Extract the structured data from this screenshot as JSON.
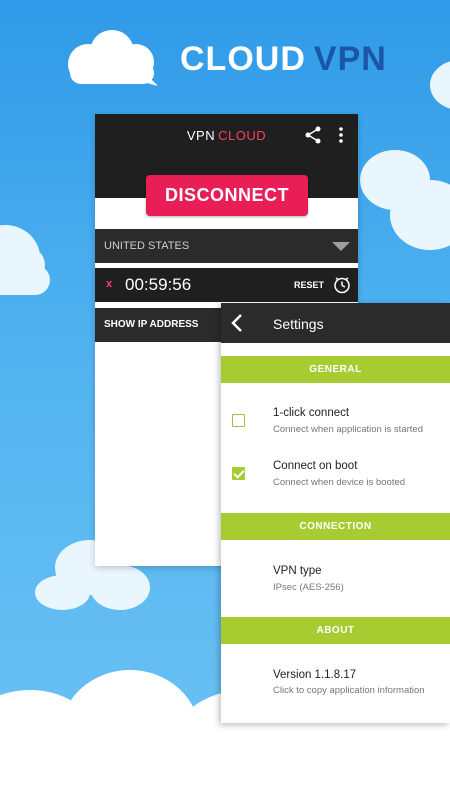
{
  "header": {
    "brand_word": "CLOUD",
    "accent_word": "VPN",
    "brand_icon": "cloud-chat-icon"
  },
  "app": {
    "title_main": "VPN",
    "title_accent": "CLOUD",
    "share_icon": "share-icon",
    "menu_icon": "overflow-menu-icon",
    "connect_button": "DISCONNECT",
    "country": "UNITED STATES",
    "timer": {
      "stop_symbol": "x",
      "value": "00:59:56",
      "reset_label": "RESET",
      "clock_icon": "clock-icon"
    },
    "show_ip_label": "SHOW IP ADDRESS"
  },
  "settings": {
    "title": "Settings",
    "back_icon": "back-arrow-icon",
    "sections": [
      {
        "header": "GENERAL",
        "items": [
          {
            "title": "1-click connect",
            "subtitle": "Connect when application is started",
            "checked": false
          },
          {
            "title": "Connect on boot",
            "subtitle": "Connect when device is booted",
            "checked": true
          }
        ]
      },
      {
        "header": "CONNECTION",
        "items": [
          {
            "title": "VPN type",
            "subtitle": "IPsec (AES-256)"
          }
        ]
      },
      {
        "header": "ABOUT",
        "items": [
          {
            "title": "Version 1.1.8.17",
            "subtitle": "Click to copy application information"
          }
        ]
      }
    ]
  },
  "colors": {
    "sky_top": "#2f9ae8",
    "accent_red": "#e91e56",
    "accent_green": "#a6cc32",
    "brand_blue": "#1a55a6",
    "dark_bar": "#1f1f1f"
  }
}
